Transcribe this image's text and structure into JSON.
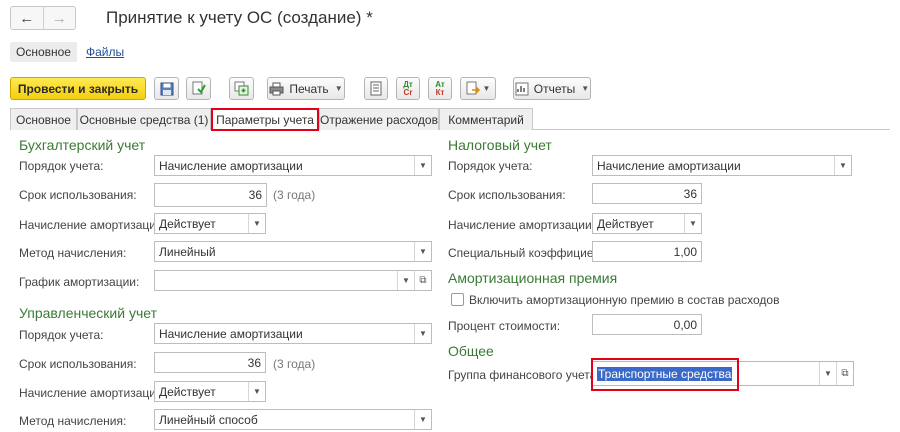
{
  "window": {
    "title": "Принятие к учету ОС (создание) *",
    "back_glyph": "←",
    "forward_glyph": "→"
  },
  "sections": {
    "main": "Основное",
    "files": "Файлы"
  },
  "toolbar": {
    "post_close": "Провести и закрыть",
    "print": "Печать",
    "reports": "Отчеты",
    "dt_cr_top": "Дт",
    "dt_cr_bottom": "Сr",
    "at_kt_top": "Ат",
    "at_kt_bottom": "Кт"
  },
  "tabs": [
    "Основное",
    "Основные средства (1)",
    "Параметры учета",
    "Отражение расходов",
    "Комментарий"
  ],
  "accounting": {
    "title": "Бухгалтерский учет",
    "order_label": "Порядок учета:",
    "order_value": "Начисление амортизации",
    "term_label": "Срок использования:",
    "term_value": "36",
    "term_hint": "(3 года)",
    "depr_label": "Начисление амортизации:",
    "depr_value": "Действует",
    "method_label": "Метод начисления:",
    "method_value": "Линейный",
    "schedule_label": "График амортизации:",
    "schedule_value": ""
  },
  "management": {
    "title": "Управленческий учет",
    "order_label": "Порядок учета:",
    "order_value": "Начисление амортизации",
    "term_label": "Срок использования:",
    "term_value": "36",
    "term_hint": "(3 года)",
    "depr_label": "Начисление амортизации:",
    "depr_value": "Действует",
    "method_label": "Метод начисления:",
    "method_value": "Линейный способ"
  },
  "tax": {
    "title": "Налоговый учет",
    "order_label": "Порядок учета:",
    "order_value": "Начисление амортизации",
    "term_label": "Срок использования:",
    "term_value": "36",
    "depr_label": "Начисление амортизации:",
    "depr_value": "Действует",
    "coef_label": "Специальный коэффициент:",
    "coef_value": "1,00"
  },
  "premium": {
    "title": "Амортизационная премия",
    "include_label": "Включить амортизационную премию в состав расходов",
    "percent_label": "Процент стоимости:",
    "percent_value": "0,00"
  },
  "general": {
    "title": "Общее",
    "group_label": "Группа финансового учета:",
    "group_value": "Транспортные средства"
  },
  "colors": {
    "accent_green": "#3b7a35",
    "primary_button": "#f3cf0d",
    "highlight_red": "#e3001b",
    "focus_yellow": "#f2c200",
    "selection_blue": "#3a69c7"
  }
}
